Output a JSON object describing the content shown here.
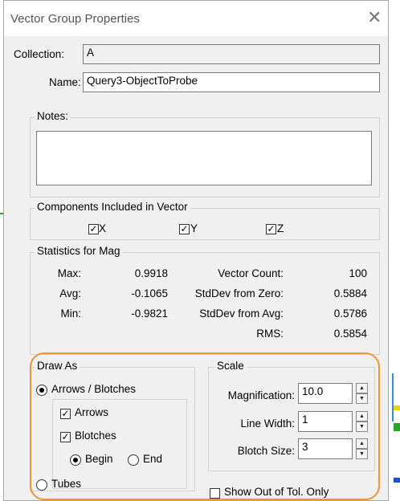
{
  "window": {
    "title": "Vector Group Properties",
    "close_glyph": "✕"
  },
  "collection": {
    "label": "Collection:",
    "value": "A"
  },
  "name": {
    "label": "Name:",
    "value": "Query3-ObjectToProbe"
  },
  "notes": {
    "label": "Notes:",
    "value": ""
  },
  "components": {
    "label": "Components Included in Vector",
    "items": [
      {
        "label": "X",
        "checked": true
      },
      {
        "label": "Y",
        "checked": true
      },
      {
        "label": "Z",
        "checked": true
      }
    ]
  },
  "statistics": {
    "label": "Statistics for Mag",
    "max_label": "Max:",
    "max_value": "0.9918",
    "avg_label": "Avg:",
    "avg_value": "-0.1065",
    "min_label": "Min:",
    "min_value": "-0.9821",
    "count_label": "Vector Count:",
    "count_value": "100",
    "sdzero_label": "StdDev from Zero:",
    "sdzero_value": "0.5884",
    "sdavg_label": "StdDev from  Avg:",
    "sdavg_value": "0.5786",
    "rms_label": "RMS:",
    "rms_value": "0.5854"
  },
  "draw_as": {
    "label": "Draw As",
    "arrows_blotches": {
      "label": "Arrows / Blotches",
      "selected": true
    },
    "arrows": {
      "label": "Arrows",
      "checked": true
    },
    "blotches": {
      "label": "Blotches",
      "checked": true
    },
    "begin": {
      "label": "Begin",
      "selected": true
    },
    "end": {
      "label": "End",
      "selected": false
    },
    "tubes": {
      "label": "Tubes",
      "selected": false
    }
  },
  "scale": {
    "label": "Scale",
    "magnification_label": "Magnification:",
    "magnification_value": "10.0",
    "line_width_label": "Line Width:",
    "line_width_value": "1",
    "blotch_size_label": "Blotch Size:",
    "blotch_size_value": "3"
  },
  "show_out_of_tol": {
    "label": "Show Out of Tol. Only",
    "checked": false
  },
  "colors": {
    "highlight": "#f0962e",
    "background_accent_green": "#2aa52a"
  }
}
